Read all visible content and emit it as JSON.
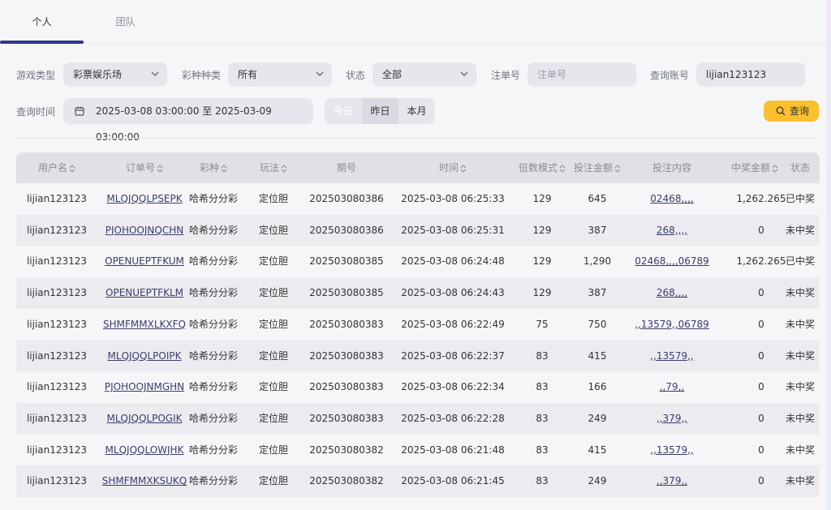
{
  "tabs": [
    {
      "label": "个人"
    },
    {
      "label": "团队"
    }
  ],
  "filters": {
    "game_type_label": "游戏类型",
    "game_type_value": "彩票娱乐场",
    "lottery_kind_label": "彩种种类",
    "lottery_kind_value": "所有",
    "status_label": "状态",
    "status_value": "全部",
    "order_no_label": "注单号",
    "order_no_placeholder": "注单号",
    "account_label": "查询账号",
    "account_value": "lijian123123",
    "time_label": "查询时间",
    "time_range": "2025-03-08 03:00:00 至 2025-03-09 03:00:00",
    "quick_today": "今日",
    "quick_yesterday": "昨日",
    "quick_month": "本月",
    "query_button": "查询"
  },
  "table": {
    "columns": [
      "用户名",
      "订单号",
      "彩种",
      "玩法",
      "期号",
      "时间",
      "倍数模式",
      "投注金额",
      "投注内容",
      "中奖金额",
      "状态"
    ],
    "rows": [
      {
        "user": "lijian123123",
        "order": "MLQJQQLPSEPK",
        "lottery": "哈希分分彩",
        "play": "定位胆",
        "issue": "202503080386",
        "time": "2025-03-08 06:25:33",
        "multiple": "129",
        "amount": "645",
        "content": "02468,,,,",
        "win": "1,262.265",
        "status": "已中奖"
      },
      {
        "user": "lijian123123",
        "order": "PJOHOOJNQCHN",
        "lottery": "哈希分分彩",
        "play": "定位胆",
        "issue": "202503080386",
        "time": "2025-03-08 06:25:31",
        "multiple": "129",
        "amount": "387",
        "content": "268,,,,",
        "win": "0",
        "status": "未中奖"
      },
      {
        "user": "lijian123123",
        "order": "OPENUEPTFKUM",
        "lottery": "哈希分分彩",
        "play": "定位胆",
        "issue": "202503080385",
        "time": "2025-03-08 06:24:48",
        "multiple": "129",
        "amount": "1,290",
        "content": "02468,,,,06789",
        "win": "1,262.265",
        "status": "已中奖"
      },
      {
        "user": "lijian123123",
        "order": "OPENUEPTFKLM",
        "lottery": "哈希分分彩",
        "play": "定位胆",
        "issue": "202503080385",
        "time": "2025-03-08 06:24:43",
        "multiple": "129",
        "amount": "387",
        "content": "268,,,,",
        "win": "0",
        "status": "未中奖"
      },
      {
        "user": "lijian123123",
        "order": "SHMFMMXLKXFQ",
        "lottery": "哈希分分彩",
        "play": "定位胆",
        "issue": "202503080383",
        "time": "2025-03-08 06:22:49",
        "multiple": "75",
        "amount": "750",
        "content": ",,13579,,06789",
        "win": "0",
        "status": "未中奖"
      },
      {
        "user": "lijian123123",
        "order": "MLQJQQLPOIPK",
        "lottery": "哈希分分彩",
        "play": "定位胆",
        "issue": "202503080383",
        "time": "2025-03-08 06:22:37",
        "multiple": "83",
        "amount": "415",
        "content": ",,13579,,",
        "win": "0",
        "status": "未中奖"
      },
      {
        "user": "lijian123123",
        "order": "PJOHOOJNMGHN",
        "lottery": "哈希分分彩",
        "play": "定位胆",
        "issue": "202503080383",
        "time": "2025-03-08 06:22:34",
        "multiple": "83",
        "amount": "166",
        "content": ",,79,,",
        "win": "0",
        "status": "未中奖"
      },
      {
        "user": "lijian123123",
        "order": "MLQJQQLPOGIK",
        "lottery": "哈希分分彩",
        "play": "定位胆",
        "issue": "202503080383",
        "time": "2025-03-08 06:22:28",
        "multiple": "83",
        "amount": "249",
        "content": ",,379,,",
        "win": "0",
        "status": "未中奖"
      },
      {
        "user": "lijian123123",
        "order": "MLQJQQLOWJHK",
        "lottery": "哈希分分彩",
        "play": "定位胆",
        "issue": "202503080382",
        "time": "2025-03-08 06:21:48",
        "multiple": "83",
        "amount": "415",
        "content": ",,13579,,",
        "win": "0",
        "status": "未中奖"
      },
      {
        "user": "lijian123123",
        "order": "SHMFMMXKSUKQ",
        "lottery": "哈希分分彩",
        "play": "定位胆",
        "issue": "202503080382",
        "time": "2025-03-08 06:21:45",
        "multiple": "83",
        "amount": "249",
        "content": ",,379,,",
        "win": "0",
        "status": "未中奖"
      }
    ]
  },
  "colors": {
    "accent": "#2b3790",
    "query_button": "#fbc02d"
  }
}
